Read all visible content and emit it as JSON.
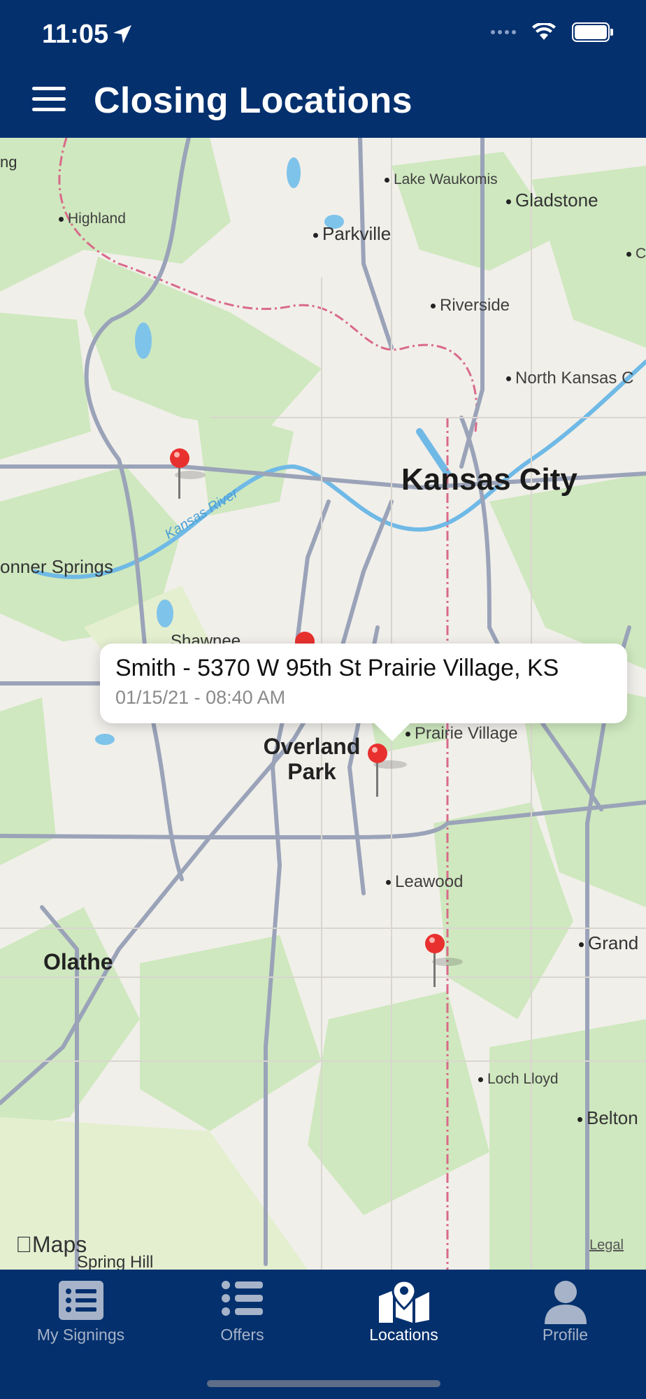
{
  "status_bar": {
    "time": "11:05"
  },
  "header": {
    "title": "Closing Locations"
  },
  "map": {
    "places": {
      "lake_waukomis": "Lake Waukomis",
      "gladstone": "Gladstone",
      "highland": "Highland",
      "parkville": "Parkville",
      "riverside": "Riverside",
      "north_kansas_city": "North Kansas C",
      "kansas_city": "Kansas City",
      "bonner_springs": "onner Springs",
      "shawnee": "Shawnee",
      "prairie_village": "Prairie Village",
      "overland_park": "Overland Park",
      "leawood": "Leawood",
      "grandview": "Grand",
      "olathe": "Olathe",
      "loch_lloyd": "Loch Lloyd",
      "belton": "Belton",
      "spring_hill": "Spring Hill",
      "bonner_top": "ng",
      "c_top": "C"
    },
    "river_label": "Kansas River",
    "attribution": "Maps",
    "legal": "Legal"
  },
  "callout": {
    "title": "Smith - 5370 W 95th St Prairie Village, KS",
    "subtitle": "01/15/21 - 08:40 AM"
  },
  "tabs": [
    {
      "label": "My Signings",
      "icon": "list-box-icon",
      "active": false
    },
    {
      "label": "Offers",
      "icon": "list-icon",
      "active": false
    },
    {
      "label": "Locations",
      "icon": "map-pin-icon",
      "active": true
    },
    {
      "label": "Profile",
      "icon": "person-icon",
      "active": false
    }
  ],
  "colors": {
    "nav": "#04306e",
    "pin": "#e8312f",
    "water": "#6fb9e6"
  }
}
